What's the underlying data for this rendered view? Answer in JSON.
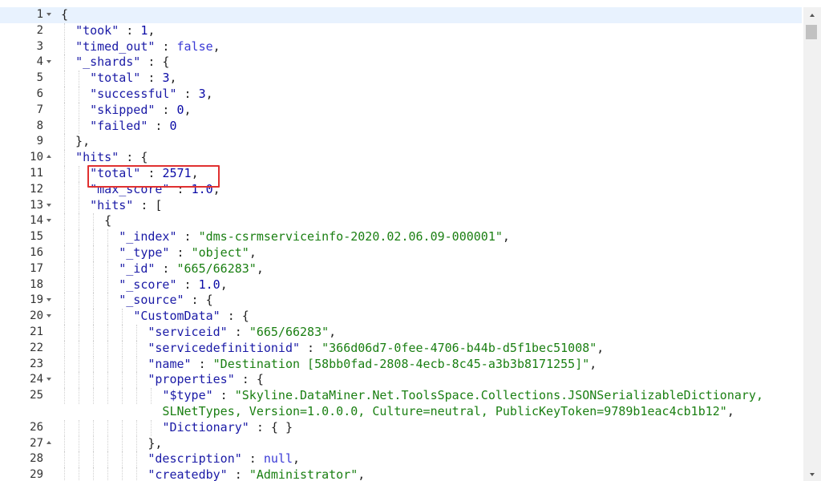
{
  "editor": {
    "lines": [
      {
        "n": "1",
        "fold": "open",
        "t": [
          [
            "p",
            "{"
          ]
        ]
      },
      {
        "n": "2",
        "fold": "",
        "t": [
          [
            "p",
            "  "
          ],
          [
            "k",
            "\"took\""
          ],
          [
            "p",
            " : "
          ],
          [
            "n",
            "1"
          ],
          [
            "p",
            ","
          ]
        ]
      },
      {
        "n": "3",
        "fold": "",
        "t": [
          [
            "p",
            "  "
          ],
          [
            "k",
            "\"timed_out\""
          ],
          [
            "p",
            " : "
          ],
          [
            "b",
            "false"
          ],
          [
            "p",
            ","
          ]
        ]
      },
      {
        "n": "4",
        "fold": "open",
        "t": [
          [
            "p",
            "  "
          ],
          [
            "k",
            "\"_shards\""
          ],
          [
            "p",
            " : {"
          ]
        ]
      },
      {
        "n": "5",
        "fold": "",
        "t": [
          [
            "p",
            "    "
          ],
          [
            "k",
            "\"total\""
          ],
          [
            "p",
            " : "
          ],
          [
            "n",
            "3"
          ],
          [
            "p",
            ","
          ]
        ]
      },
      {
        "n": "6",
        "fold": "",
        "t": [
          [
            "p",
            "    "
          ],
          [
            "k",
            "\"successful\""
          ],
          [
            "p",
            " : "
          ],
          [
            "n",
            "3"
          ],
          [
            "p",
            ","
          ]
        ]
      },
      {
        "n": "7",
        "fold": "",
        "t": [
          [
            "p",
            "    "
          ],
          [
            "k",
            "\"skipped\""
          ],
          [
            "p",
            " : "
          ],
          [
            "n",
            "0"
          ],
          [
            "p",
            ","
          ]
        ]
      },
      {
        "n": "8",
        "fold": "",
        "t": [
          [
            "p",
            "    "
          ],
          [
            "k",
            "\"failed\""
          ],
          [
            "p",
            " : "
          ],
          [
            "n",
            "0"
          ]
        ]
      },
      {
        "n": "9",
        "fold": "",
        "t": [
          [
            "p",
            "  },"
          ]
        ]
      },
      {
        "n": "10",
        "fold": "close",
        "t": [
          [
            "p",
            "  "
          ],
          [
            "k",
            "\"hits\""
          ],
          [
            "p",
            " : {"
          ]
        ]
      },
      {
        "n": "11",
        "fold": "",
        "t": [
          [
            "p",
            "    "
          ],
          [
            "k",
            "\"total\""
          ],
          [
            "p",
            " : "
          ],
          [
            "n",
            "2571"
          ],
          [
            "p",
            ","
          ]
        ]
      },
      {
        "n": "12",
        "fold": "",
        "t": [
          [
            "p",
            "    "
          ],
          [
            "k",
            "\"max_score\""
          ],
          [
            "p",
            " : "
          ],
          [
            "n",
            "1.0"
          ],
          [
            "p",
            ","
          ]
        ]
      },
      {
        "n": "13",
        "fold": "open",
        "t": [
          [
            "p",
            "    "
          ],
          [
            "k",
            "\"hits\""
          ],
          [
            "p",
            " : ["
          ]
        ]
      },
      {
        "n": "14",
        "fold": "open",
        "t": [
          [
            "p",
            "      {"
          ]
        ]
      },
      {
        "n": "15",
        "fold": "",
        "t": [
          [
            "p",
            "        "
          ],
          [
            "k",
            "\"_index\""
          ],
          [
            "p",
            " : "
          ],
          [
            "s",
            "\"dms-csrmserviceinfo-2020.02.06.09-000001\""
          ],
          [
            "p",
            ","
          ]
        ]
      },
      {
        "n": "16",
        "fold": "",
        "t": [
          [
            "p",
            "        "
          ],
          [
            "k",
            "\"_type\""
          ],
          [
            "p",
            " : "
          ],
          [
            "s",
            "\"object\""
          ],
          [
            "p",
            ","
          ]
        ]
      },
      {
        "n": "17",
        "fold": "",
        "t": [
          [
            "p",
            "        "
          ],
          [
            "k",
            "\"_id\""
          ],
          [
            "p",
            " : "
          ],
          [
            "s",
            "\"665/66283\""
          ],
          [
            "p",
            ","
          ]
        ]
      },
      {
        "n": "18",
        "fold": "",
        "t": [
          [
            "p",
            "        "
          ],
          [
            "k",
            "\"_score\""
          ],
          [
            "p",
            " : "
          ],
          [
            "n",
            "1.0"
          ],
          [
            "p",
            ","
          ]
        ]
      },
      {
        "n": "19",
        "fold": "open",
        "t": [
          [
            "p",
            "        "
          ],
          [
            "k",
            "\"_source\""
          ],
          [
            "p",
            " : {"
          ]
        ]
      },
      {
        "n": "20",
        "fold": "open",
        "t": [
          [
            "p",
            "          "
          ],
          [
            "k",
            "\"CustomData\""
          ],
          [
            "p",
            " : {"
          ]
        ]
      },
      {
        "n": "21",
        "fold": "",
        "t": [
          [
            "p",
            "            "
          ],
          [
            "k",
            "\"serviceid\""
          ],
          [
            "p",
            " : "
          ],
          [
            "s",
            "\"665/66283\""
          ],
          [
            "p",
            ","
          ]
        ]
      },
      {
        "n": "22",
        "fold": "",
        "t": [
          [
            "p",
            "            "
          ],
          [
            "k",
            "\"servicedefinitionid\""
          ],
          [
            "p",
            " : "
          ],
          [
            "s",
            "\"366d06d7-0fee-4706-b44b-d5f1bec51008\""
          ],
          [
            "p",
            ","
          ]
        ]
      },
      {
        "n": "23",
        "fold": "",
        "t": [
          [
            "p",
            "            "
          ],
          [
            "k",
            "\"name\""
          ],
          [
            "p",
            " : "
          ],
          [
            "s",
            "\"Destination [58bb0fad-2808-4ecb-8c45-a3b3b8171255]\""
          ],
          [
            "p",
            ","
          ]
        ]
      },
      {
        "n": "24",
        "fold": "open",
        "t": [
          [
            "p",
            "            "
          ],
          [
            "k",
            "\"properties\""
          ],
          [
            "p",
            " : {"
          ]
        ]
      },
      {
        "n": "25",
        "fold": "",
        "t": [
          [
            "p",
            "              "
          ],
          [
            "k",
            "\"$type\""
          ],
          [
            "p",
            " : "
          ],
          [
            "s",
            "\"Skyline.DataMiner.Net.ToolsSpace.Collections.JSONSerializableDictionary,"
          ]
        ]
      },
      {
        "n": "",
        "fold": "",
        "t": [
          [
            "s",
            "              SLNetTypes, Version=1.0.0.0, Culture=neutral, PublicKeyToken=9789b1eac4cb1b12\""
          ],
          [
            "p",
            ","
          ]
        ]
      },
      {
        "n": "26",
        "fold": "",
        "t": [
          [
            "p",
            "              "
          ],
          [
            "k",
            "\"Dictionary\""
          ],
          [
            "p",
            " : { }"
          ]
        ]
      },
      {
        "n": "27",
        "fold": "close",
        "t": [
          [
            "p",
            "            },"
          ]
        ]
      },
      {
        "n": "28",
        "fold": "",
        "t": [
          [
            "p",
            "            "
          ],
          [
            "k",
            "\"description\""
          ],
          [
            "p",
            " : "
          ],
          [
            "b",
            "null"
          ],
          [
            "p",
            ","
          ]
        ]
      },
      {
        "n": "29",
        "fold": "",
        "t": [
          [
            "p",
            "            "
          ],
          [
            "k",
            "\"createdby\""
          ],
          [
            "p",
            " : "
          ],
          [
            "s",
            "\"Administrator\""
          ],
          [
            "p",
            ","
          ]
        ]
      }
    ]
  },
  "colors": {
    "key": "#1a1aa6",
    "string": "#1a7f12",
    "number": "#0a0aa6",
    "boolean_null": "#3a3ad6",
    "highlight_border": "#e03030",
    "active_line": "#e8f2fe"
  }
}
